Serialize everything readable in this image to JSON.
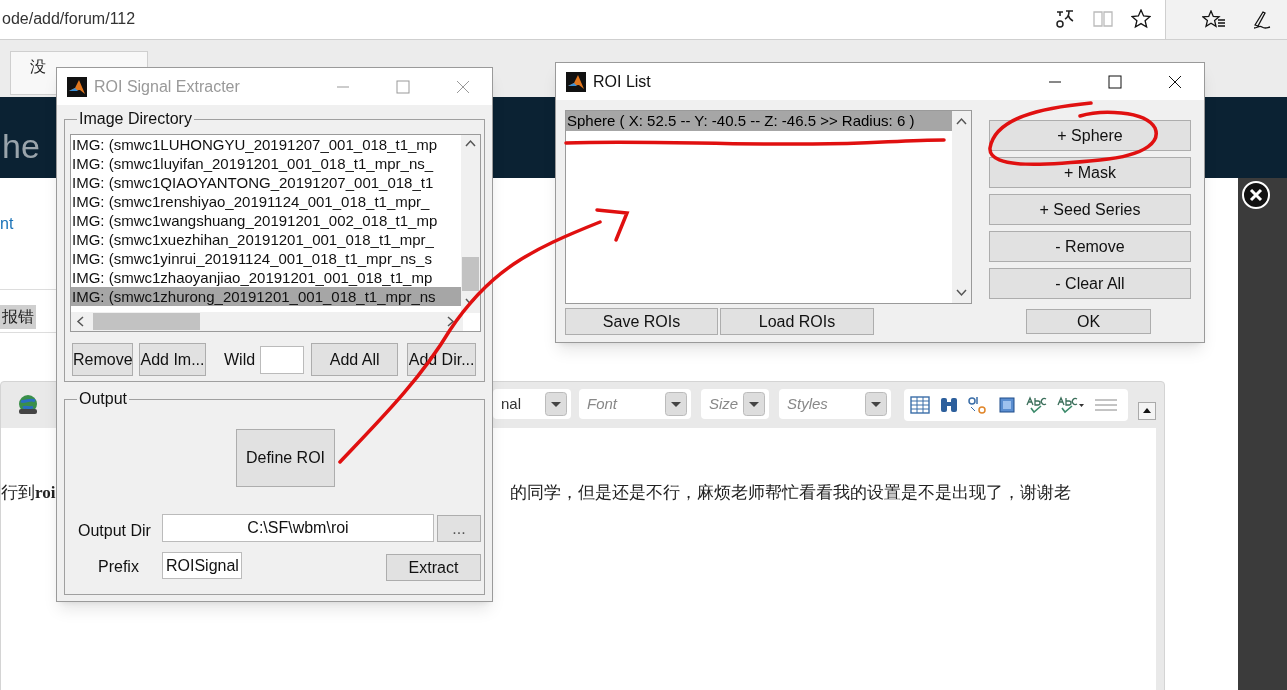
{
  "browser": {
    "address": "ode/add/forum/112",
    "find_result": "没"
  },
  "page": {
    "header_title": "he",
    "link": "nt",
    "highlight": "报错",
    "editor": {
      "format": "nal",
      "font": "Font",
      "size": "Size",
      "styles": "Styles",
      "body_left": "行到**roi**",
      "body_right": "的同学，但是还是不行，麻烦老师帮忙看看我的设置是不是出现了，谢谢老"
    }
  },
  "extracter": {
    "title": "ROI Signal Extracter",
    "image_directory": {
      "label": "Image Directory",
      "files": [
        {
          "text": "IMG: (smwc1LUHONGYU_20191207_001_018_t1_mp",
          "selected": false
        },
        {
          "text": "IMG: (smwc1luyifan_20191201_001_018_t1_mpr_ns_",
          "selected": false
        },
        {
          "text": "IMG: (smwc1QIAOYANTONG_20191207_001_018_t1",
          "selected": false
        },
        {
          "text": "IMG: (smwc1renshiyao_20191124_001_018_t1_mpr_",
          "selected": false
        },
        {
          "text": "IMG: (smwc1wangshuang_20191201_002_018_t1_mp",
          "selected": false
        },
        {
          "text": "IMG: (smwc1xuezhihan_20191201_001_018_t1_mpr_",
          "selected": false
        },
        {
          "text": "IMG: (smwc1yinrui_20191124_001_018_t1_mpr_ns_s",
          "selected": false
        },
        {
          "text": "IMG: (smwc1zhaoyanjiao_20191201_001_018_t1_mp",
          "selected": false
        },
        {
          "text": "IMG: (smwc1zhurong_20191201_001_018_t1_mpr_ns",
          "selected": true
        }
      ],
      "remove_button": "Remove",
      "add_image_button": "Add Im...",
      "wild_label": "Wild",
      "add_all_button": "Add All",
      "add_dir_button": "Add Dir..."
    },
    "output": {
      "label": "Output",
      "define_button": "Define ROI",
      "dir_label": "Output Dir",
      "dir_value": "C:\\SF\\wbm\\roi",
      "browse_button": "...",
      "prefix_label": "Prefix",
      "prefix_value": "ROISignal",
      "extract_button": "Extract"
    }
  },
  "roi_list": {
    "title": "ROI List",
    "rois": [
      {
        "text": "Sphere ( X: 52.5 -- Y: -40.5 -- Z: -46.5 >> Radius: 6 )",
        "selected": true
      }
    ],
    "buttons": [
      "+ Sphere",
      "+ Mask",
      "+ Seed Series",
      "- Remove",
      "- Clear All"
    ],
    "save_button": "Save ROIs",
    "load_button": "Load ROIs",
    "ok_button": "OK"
  }
}
